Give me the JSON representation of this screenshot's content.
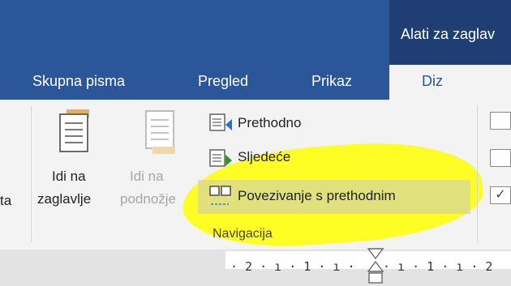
{
  "title_bar": {
    "context_tab_group": "Alati za zaglav"
  },
  "tabs": [
    {
      "label": "Skupna pisma"
    },
    {
      "label": "Pregled"
    },
    {
      "label": "Prikaz"
    },
    {
      "label": "Diz"
    }
  ],
  "ribbon": {
    "clipped_left": "ta",
    "goto_header": {
      "line1": "Idi na",
      "line2": "zaglavlje"
    },
    "goto_footer": {
      "line1": "Idi na",
      "line2": "podnožje"
    },
    "previous": "Prethodno",
    "next": "Sljedeće",
    "link_to_previous": "Povezivanje s prethodnim",
    "group_label": "Navigacija",
    "options": [
      {
        "checked": false
      },
      {
        "checked": false
      },
      {
        "checked": true
      }
    ]
  },
  "ruler": {
    "left_marks": "· 2 · ı · 1 · ı ·",
    "right_marks": "· ı · 1 · ı · 2"
  },
  "colors": {
    "title_blue": "#2b579a",
    "context_blue": "#1f3f74",
    "highlight": "#ffff00",
    "ribbon_bg": "#f3f3f3"
  }
}
